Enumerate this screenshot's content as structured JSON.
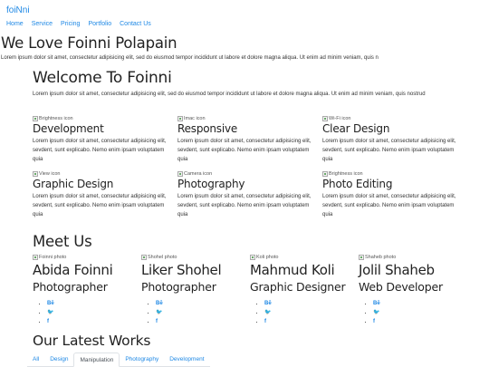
{
  "navbar": {
    "brand": "foiNni",
    "links": [
      "Home",
      "Service",
      "Pricing",
      "Portfolio",
      "Contact Us"
    ]
  },
  "hero": {
    "title": "We Love Foinni Polapain",
    "text": "Lorem ipsum dolor sit amet, consectetur adipisicing elit, sed do eiusmod tempor incididunt ut labore et dolore magna aliqua. Ut enim ad minim veniam, quis n"
  },
  "welcome": {
    "title": "Welcome To Foinni",
    "text": "Lorem ipsum dolor sit amet, consectetur adipisicing elit, sed do eiusmod tempor incididunt ut labore et dolore magna aliqua. Ut enim ad minim veniam, quis nostrud"
  },
  "features": [
    {
      "icon_alt": "Brightness icon",
      "title": "Development",
      "text": "Lorem ipsum dolor sit amet, consectetur adipisicing elit, sevdent, sunt explicabo. Nemo enim ipsam voluptatem quia"
    },
    {
      "icon_alt": "Imac icon",
      "title": "Responsive",
      "text": "Lorem ipsum dolor sit amet, consectetur adipisicing elit, sevdent, sunt explicabo. Nemo enim ipsam voluptatem quia"
    },
    {
      "icon_alt": "Wi-Fi icon",
      "title": "Clear Design",
      "text": "Lorem ipsum dolor sit amet, consectetur adipisicing elit, sevdent, sunt explicabo. Nemo enim ipsam voluptatem quia"
    },
    {
      "icon_alt": "View icon",
      "title": "Graphic Design",
      "text": "Lorem ipsum dolor sit amet, consectetur adipisicing elit, sevdent, sunt explicabo. Nemo enim ipsam voluptatem quia"
    },
    {
      "icon_alt": "Camera icon",
      "title": "Photography",
      "text": "Lorem ipsum dolor sit amet, consectetur adipisicing elit, sevdent, sunt explicabo. Nemo enim ipsam voluptatem quia"
    },
    {
      "icon_alt": "Brightness icon",
      "title": "Photo Editing",
      "text": "Lorem ipsum dolor sit amet, consectetur adipisicing elit, sevdent, sunt explicabo. Nemo enim ipsam voluptatem quia"
    }
  ],
  "meet": {
    "title": "Meet Us",
    "members": [
      {
        "photo_alt": "Foinni photo",
        "name": "Abida Foinni",
        "role": "Photographer",
        "social": [
          "Bē",
          "🐦",
          "f"
        ]
      },
      {
        "photo_alt": "Shohel photo",
        "name": "Liker Shohel",
        "role": "Photographer",
        "social": [
          "Bē",
          "🐦",
          "f"
        ]
      },
      {
        "photo_alt": "Koli photo",
        "name": "Mahmud Koli",
        "role": "Graphic Designer",
        "social": [
          "Bē",
          "🐦",
          "f"
        ]
      },
      {
        "photo_alt": "Shaheb photo",
        "name": "Jolil Shaheb",
        "role": "Web Developer",
        "social": [
          "Bē",
          "🐦",
          "f"
        ]
      }
    ]
  },
  "works": {
    "title": "Our Latest Works",
    "tabs": [
      "All",
      "Design",
      "Manipulation",
      "Photography",
      "Development"
    ],
    "active_tab": "Manipulation"
  },
  "colors": {
    "link": "#1e88e5",
    "heading": "#222222",
    "text": "#333333"
  },
  "social_icons": [
    "behance-icon",
    "twitter-icon",
    "facebook-icon"
  ]
}
